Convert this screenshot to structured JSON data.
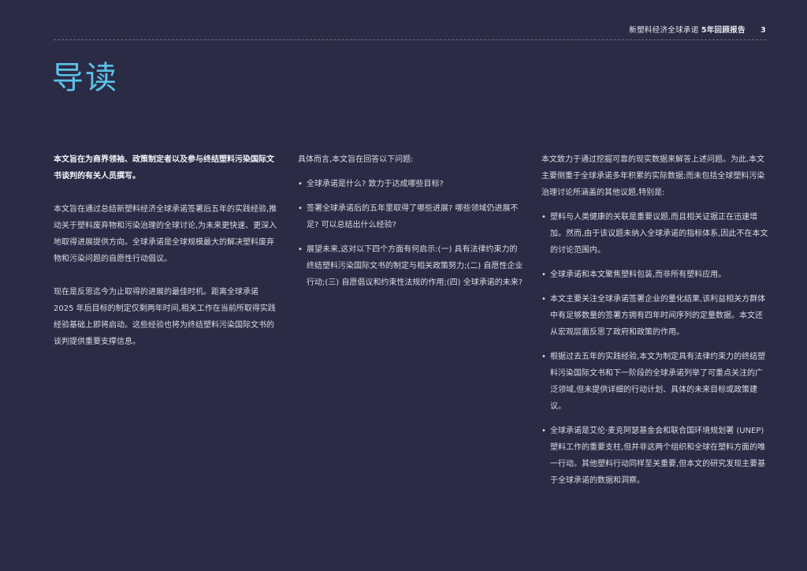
{
  "header": {
    "doc_title": "新塑料经济全球承诺",
    "doc_subtitle": "5年回顾报告",
    "page_number": "3"
  },
  "title": "导读",
  "col1": {
    "lead": "本文旨在为商界领袖、政策制定者以及参与终结塑料污染国际文书谈判的有关人员撰写。",
    "p1": "本文旨在通过总结新塑料经济全球承诺签署后五年的实践经验,推动关于塑料废弃物和污染治理的全球讨论,为未来更快速、更深入地取得进展提供方向。全球承诺是全球规模最大的解决塑料废弃物和污染问题的自愿性行动倡议。",
    "p2": "现在是反思迄今为止取得的进展的最佳时机。距离全球承诺 2025 年后目标的制定仅剩两年时间,相关工作在当前所取得实践经验基础上即将启动。这些经验也将为终结塑料污染国际文书的谈判提供重要支撑信息。"
  },
  "col2": {
    "intro": "具体而言,本文旨在回答以下问题:",
    "bullets": [
      "全球承诺是什么? 致力于达成哪些目标?",
      "签署全球承诺后的五年里取得了哪些进展? 哪些领域仍进展不足? 可以总结出什么经验?",
      "展望未来,这对以下四个方面有何启示:(一) 具有法律约束力的终结塑料污染国际文书的制定与相关政策努力;(二) 自愿性企业行动;(三) 自愿倡议和约束性法规的作用;(四) 全球承诺的未来?"
    ]
  },
  "col3": {
    "intro": "本文致力于通过挖掘可靠的现实数据来解答上述问题。为此,本文主要侧重于全球承诺多年积累的实际数据;而未包括全球塑料污染治理讨论所涵盖的其他议题,特别是:",
    "bullets": [
      "塑料与人类健康的关联是重要议题,而且相关证据正在迅速增加。然而,由于该议题未纳入全球承诺的指标体系,因此不在本文的讨论范围内。",
      "全球承诺和本文聚焦塑料包装,而非所有塑料应用。",
      "本文主要关注全球承诺签署企业的量化结果,该利益相关方群体中有足够数量的签署方拥有四年时间序列的定量数据。本文还从宏观层面反思了政府和政策的作用。",
      "根据过去五年的实践经验,本文为制定具有法律约束力的终结塑料污染国际文书和下一阶段的全球承诺列举了可重点关注的广泛领域,但未提供详细的行动计划、具体的未来目标或政策建议。",
      "全球承诺是艾伦·麦克阿瑟基金会和联合国环境规划署 (UNEP) 塑料工作的重要支柱,但并非这两个组织和全球在塑料方面的唯一行动。其他塑料行动同样至关重要,但本文的研究发现主要基于全球承诺的数据和洞察。"
    ]
  }
}
